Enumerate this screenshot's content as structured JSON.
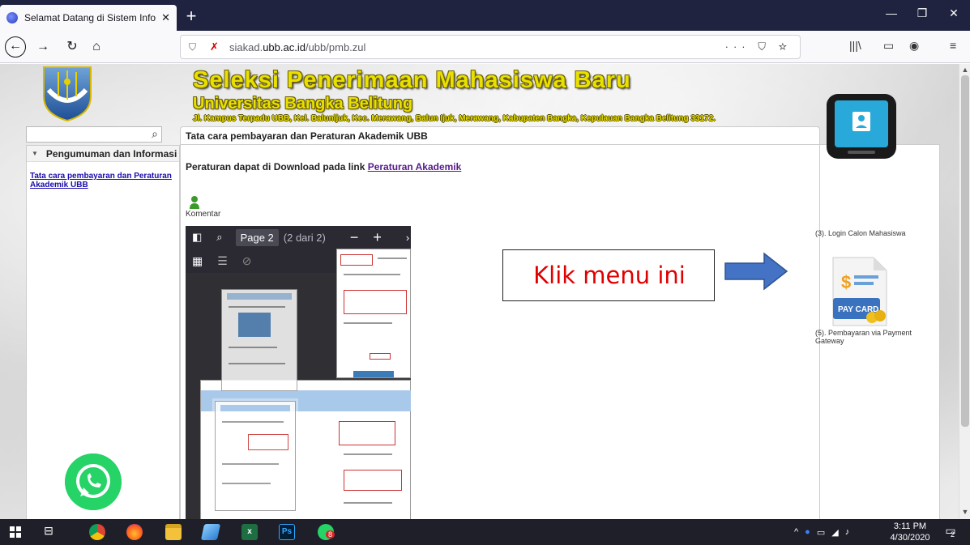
{
  "browser": {
    "tab_title": "Selamat Datang di Sistem Infor",
    "url_prefix": "siakad.",
    "url_domain": "ubb.ac.id",
    "url_path": "/ubb/pmb.zul",
    "url_actions": "··· ⛉ ☆"
  },
  "header": {
    "title": "Seleksi Penerimaan Mahasiswa Baru",
    "subtitle": "Universitas Bangka Belitung",
    "address": "Jl. Kampus Terpadu UBB, Kel. Balunijuk, Kec. Merawang, Balun Ijuk, Merawang, Kabupaten Bangka, Kepulauan Bangka Belitung 33172."
  },
  "sidebar": {
    "section_title": "Pengumuman dan Informasi",
    "items": [
      {
        "label": "Tata cara pembayaran dan Peraturan Akademik UBB"
      }
    ]
  },
  "main": {
    "tab_title": "Tata cara pembayaran dan Peraturan Akademik UBB",
    "info_text": "Peraturan dapat di Download pada link ",
    "info_link": "Peraturan Akademik",
    "komentar": "Komentar"
  },
  "pdf_viewer": {
    "page_label": "Page 2",
    "page_of": "(2 dari 2)"
  },
  "annotation": {
    "text": "Klik menu ini"
  },
  "right_menu": {
    "items": [
      {
        "label": "(3). Login Calon Mahasiswa"
      },
      {
        "label": "(5). Pembayaran via Payment Gateway"
      }
    ],
    "pay_card_text": "PAY CARD"
  },
  "taskbar": {
    "time": "3:11 PM",
    "date": "4/30/2020",
    "notif_count": "2",
    "wa_badge": "8"
  },
  "colors": {
    "title_yellow": "#e8e000",
    "annotation_red": "#e00000",
    "arrow_blue": "#4472c4",
    "whatsapp_green": "#25d366"
  }
}
